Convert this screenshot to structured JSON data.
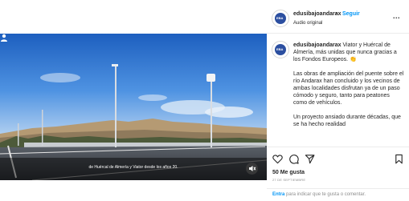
{
  "post": {
    "username": "edusibajoandarax",
    "separator": "•",
    "follow_label": "Seguir",
    "audio_label": "Audio original",
    "more_label": "...",
    "avatar_initials": "EBA"
  },
  "caption": {
    "first_line": "Viator y Huércal de Almería, más unidas que nunca gracias a los Fondos Europeos. 👏",
    "paragraph_2": "Las obras de ampliación del puente sobre el río Andarax han concluido y los vecinos de ambas localidades disfrutan ya de un paso cómodo y seguro, tanto para peatones como de vehículos.",
    "paragraph_3": "Un proyecto ansiado durante décadas, que se ha hecho realidad"
  },
  "video": {
    "subtitle": "de Huércal de Almería y Viator desde los años 20."
  },
  "stats": {
    "likes": "50 Me gusta",
    "date": "27 DE SEPTIEMBRE"
  },
  "footer": {
    "link": "Entra",
    "text": " para indicar que te gusta o comentar."
  },
  "icons": [
    "heart-icon",
    "comment-icon",
    "share-icon",
    "bookmark-icon",
    "more-icon",
    "user-tag-icon",
    "volume-off-icon"
  ]
}
